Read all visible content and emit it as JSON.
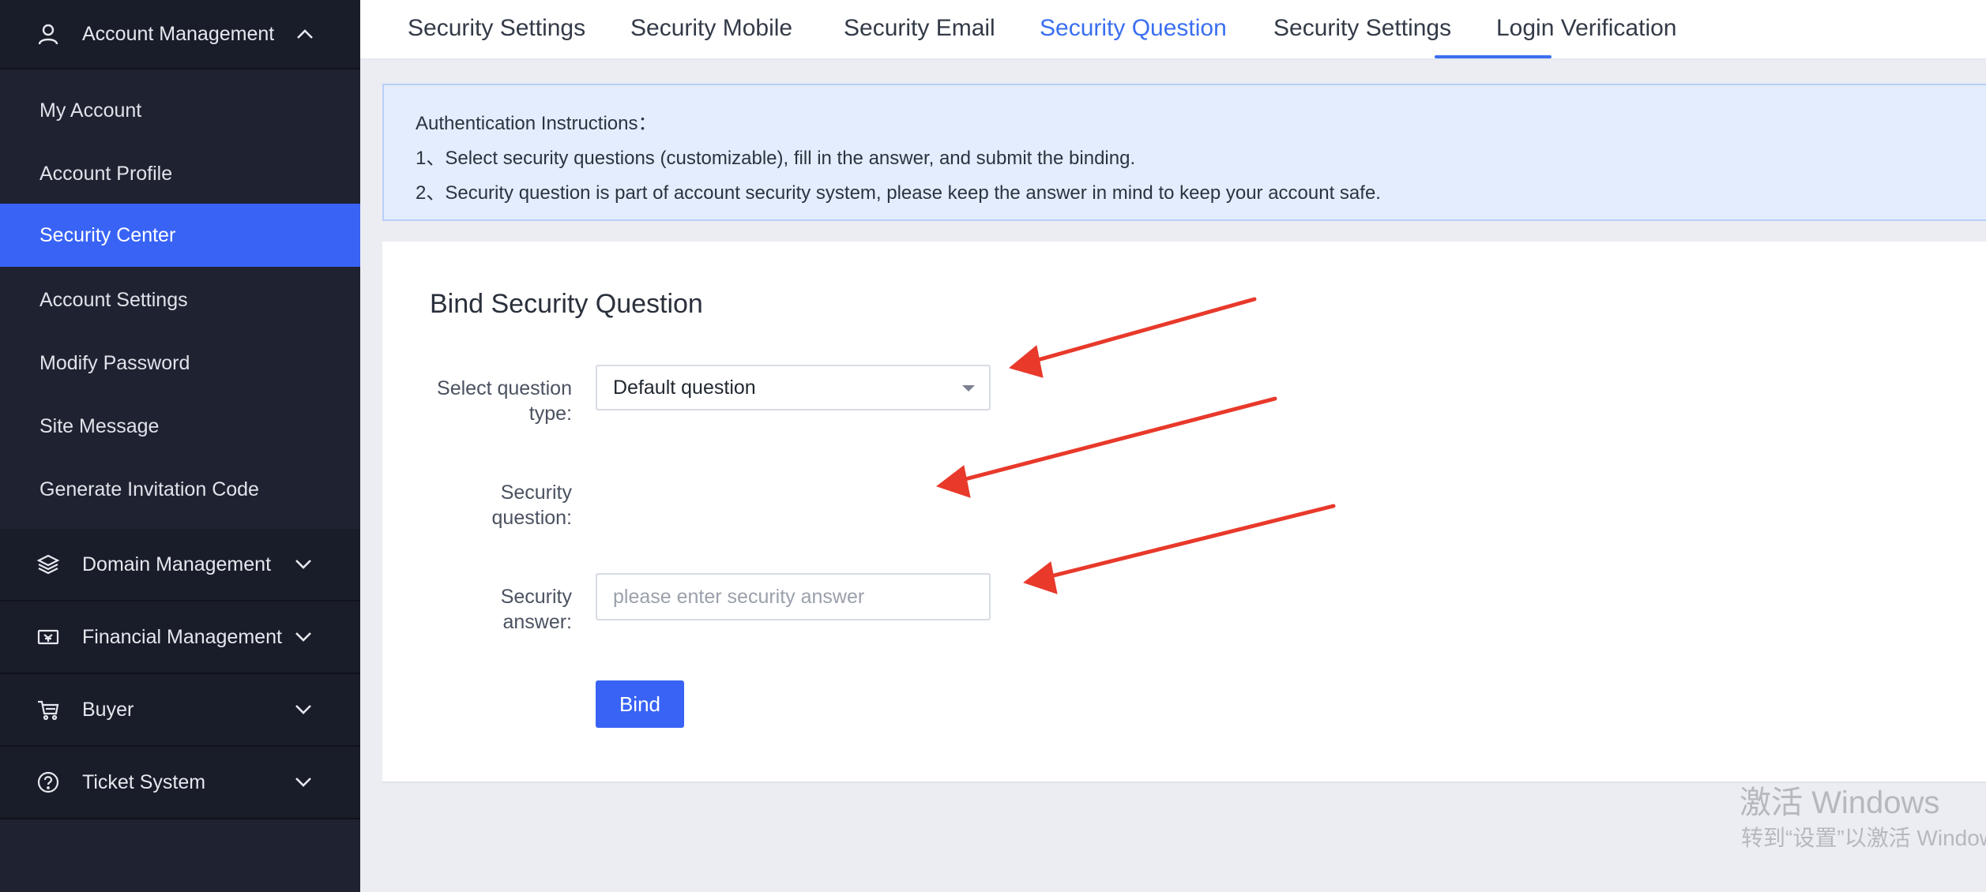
{
  "sidebar": {
    "account_management": {
      "label": "Account Management",
      "icon": "user-icon"
    },
    "account_items": [
      {
        "label": "My Account"
      },
      {
        "label": "Account Profile"
      },
      {
        "label": "Security Center",
        "active": true
      },
      {
        "label": "Account Settings"
      },
      {
        "label": "Modify Password"
      },
      {
        "label": "Site Message"
      },
      {
        "label": "Generate Invitation Code"
      }
    ],
    "groups": [
      {
        "label": "Domain Management",
        "icon": "layers-icon"
      },
      {
        "label": "Financial Management",
        "icon": "ticket-icon"
      },
      {
        "label": "Buyer",
        "icon": "cart-icon"
      },
      {
        "label": "Ticket System",
        "icon": "help-icon"
      }
    ]
  },
  "tabs": [
    {
      "label": "Security Settings"
    },
    {
      "label": "Security Mobile"
    },
    {
      "label": "Security Email"
    },
    {
      "label": "Security Question",
      "active": true
    },
    {
      "label": "Security Settings"
    },
    {
      "label": "Login Verification"
    }
  ],
  "instructions": {
    "title": "Authentication Instructions：",
    "line1": "1、Select security questions (customizable), fill in the answer, and submit the binding.",
    "line2": "2、Security question is part of account security system, please keep the answer in mind to keep your account safe."
  },
  "form": {
    "title": "Bind Security Question",
    "question_type_label_1": "Select question",
    "question_type_label_2": "type:",
    "question_type_value": "Default question",
    "security_question_label_1": "Security",
    "security_question_label_2": "question:",
    "security_answer_label_1": "Security",
    "security_answer_label_2": "answer:",
    "answer_placeholder": "please enter security answer",
    "bind_label": "Bind"
  },
  "watermark": {
    "line1": "激活 Windows",
    "line2": "转到“设置”以激活 Windows。"
  },
  "colors": {
    "accent": "#3863f5",
    "sidebar_bg": "#1f2230",
    "arrow": "#e8392b"
  }
}
